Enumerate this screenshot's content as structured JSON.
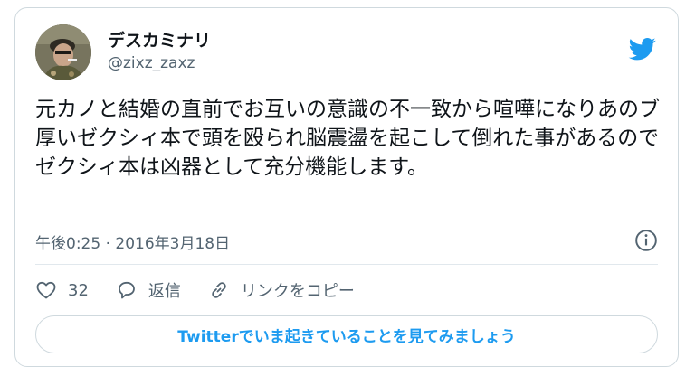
{
  "user": {
    "display_name": "デスカミナリ",
    "handle": "@zixz_zaxz"
  },
  "tweet": {
    "text": "元カノと結婚の直前でお互いの意識の不一致から喧嘩になりあのブ厚いゼクシィ本で頭を殴られ脳震盪を起こして倒れた事があるのでゼクシィ本は凶器として充分機能します。",
    "timestamp": "午後0:25 · 2016年3月18日"
  },
  "actions": {
    "like_count": "32",
    "reply_label": "返信",
    "copy_link_label": "リンクをコピー"
  },
  "cta": {
    "label": "Twitterでいま起きていることを見てみましょう"
  },
  "colors": {
    "twitter_blue": "#1d9bf0",
    "text_primary": "#0f1419",
    "text_secondary": "#536471",
    "border": "#cfd9de"
  },
  "icons": [
    "twitter-bird-icon",
    "info-icon",
    "heart-icon",
    "reply-icon",
    "link-icon"
  ]
}
